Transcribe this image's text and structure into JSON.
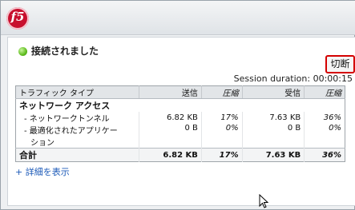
{
  "app": {
    "logo_text": "f5"
  },
  "status": {
    "text": "接続されました",
    "color": "#5fbd1f"
  },
  "disconnect_button": {
    "label": "切断",
    "border_color": "#d40000"
  },
  "session": {
    "text": "Session duration: 00:00:15"
  },
  "table": {
    "headers": {
      "type": "トラフィック タイプ",
      "sent": "送信",
      "sent_comp": "圧縮",
      "recv": "受信",
      "recv_comp": "圧縮"
    },
    "rows": {
      "network_access": {
        "label": "ネットワーク アクセス"
      },
      "tunnel": {
        "label": "- ネットワークトンネル",
        "sent": "6.82 KB",
        "sent_comp": "17%",
        "recv": "7.63 KB",
        "recv_comp": "36%"
      },
      "optimized": {
        "label_line1": "- 最適化されたアプリケー",
        "label_line2": "ション",
        "sent": "0 B",
        "sent_comp": "0%",
        "recv": "0 B",
        "recv_comp": "0%"
      },
      "total": {
        "label": "合計",
        "sent": "6.82 KB",
        "sent_comp": "17%",
        "recv": "7.63 KB",
        "recv_comp": "36%"
      }
    }
  },
  "details_link": {
    "label": "+ 詳細を表示"
  }
}
